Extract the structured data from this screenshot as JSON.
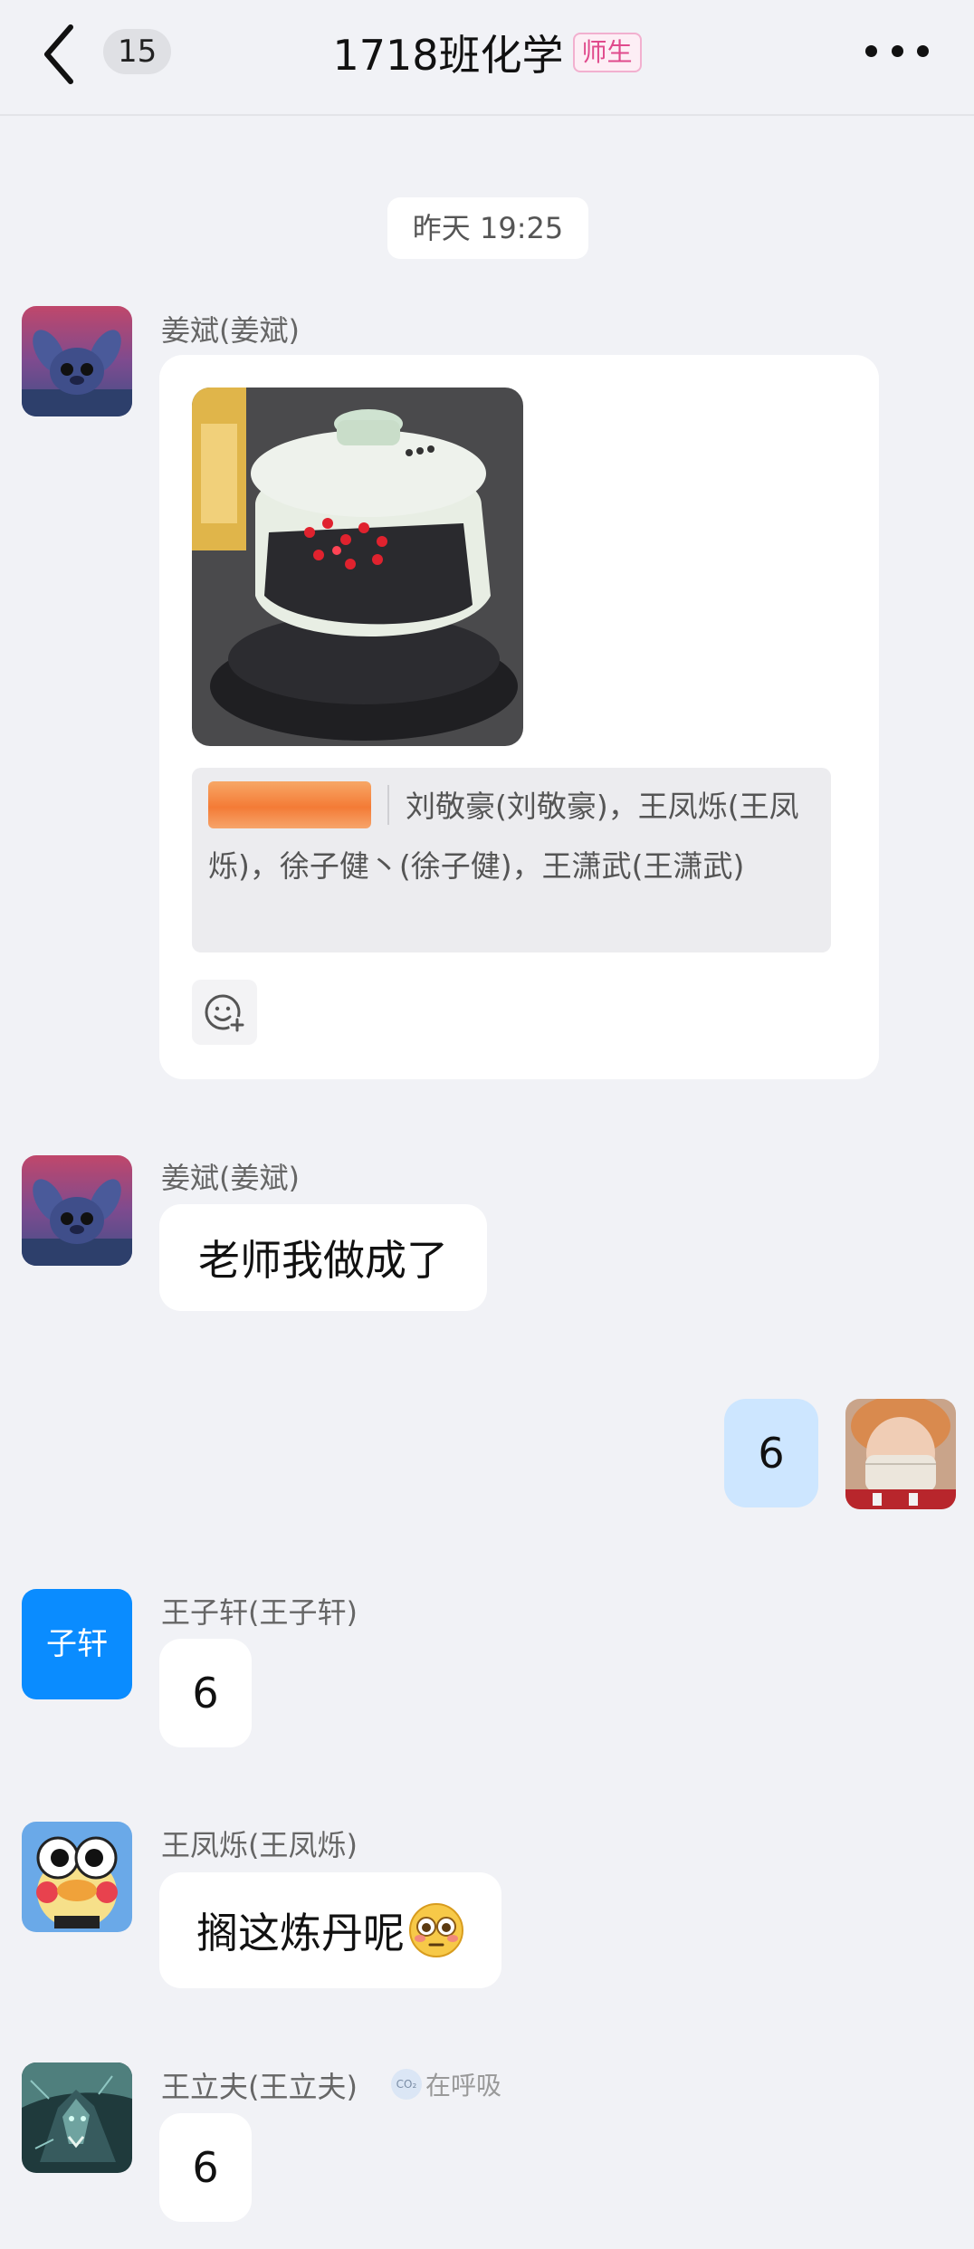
{
  "header": {
    "unread_count": "15",
    "title": "1718班化学",
    "tag": "师生"
  },
  "timestamp": "昨天 19:25",
  "messages": [
    {
      "sender": "姜斌(姜斌)",
      "mention_line": "刘敬豪(刘敬豪)，王凤烁(王凤烁)，徐子健丶(徐子健)，王潇武(王潇武)"
    },
    {
      "sender": "姜斌(姜斌)",
      "text": "老师我做成了"
    },
    {
      "text": "6"
    },
    {
      "sender": "王子轩(王子轩)",
      "avatar_text": "子轩",
      "text": "6"
    },
    {
      "sender": "王凤烁(王凤烁)",
      "text": "搁这炼丹呢"
    },
    {
      "sender": "王立夫(王立夫)",
      "status_badge": "CO₂",
      "status": "在呼吸",
      "text": "6"
    }
  ],
  "colors": {
    "self_bubble": "#cde6ff",
    "avatar_blue": "#0a8cff",
    "tag_pink": "#e04a8c",
    "background": "#f1f2f6"
  },
  "icons": [
    "back-arrow-icon",
    "more-icon",
    "add-reaction-icon",
    "flushed-emoji-icon"
  ]
}
